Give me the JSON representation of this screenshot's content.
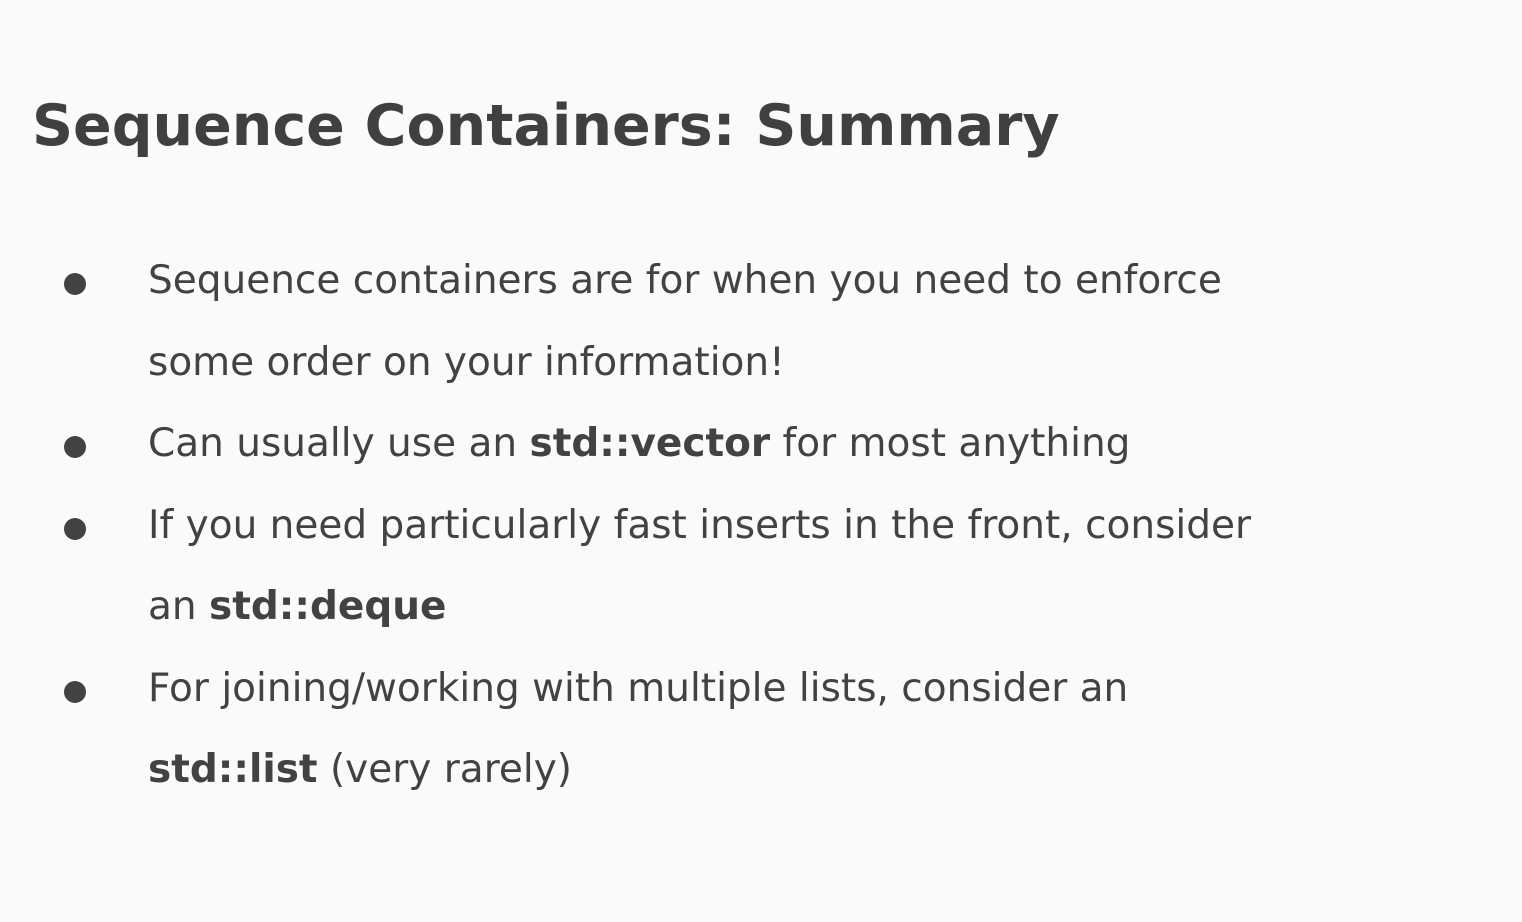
{
  "slide": {
    "title": "Sequence Containers: Summary",
    "bullets": [
      {
        "lines": [
          [
            {
              "text": "Sequence containers are for when you need to enforce",
              "bold": false
            }
          ],
          [
            {
              "text": "some order on your information!",
              "bold": false
            }
          ]
        ]
      },
      {
        "lines": [
          [
            {
              "text": "Can usually use an ",
              "bold": false
            },
            {
              "text": "std::vector",
              "bold": true
            },
            {
              "text": " for most anything",
              "bold": false
            }
          ]
        ]
      },
      {
        "lines": [
          [
            {
              "text": "If you need particularly fast inserts in the front, consider",
              "bold": false
            }
          ],
          [
            {
              "text": "an ",
              "bold": false
            },
            {
              "text": "std::deque",
              "bold": true
            }
          ]
        ]
      },
      {
        "lines": [
          [
            {
              "text": "For joining/working with multiple lists, consider an",
              "bold": false
            }
          ],
          [
            {
              "text": "std::list",
              "bold": true
            },
            {
              "text": " (very rarely)",
              "bold": false
            }
          ]
        ]
      }
    ]
  },
  "colors": {
    "background": "#fafafa",
    "text": "#424242",
    "title": "#404040"
  }
}
